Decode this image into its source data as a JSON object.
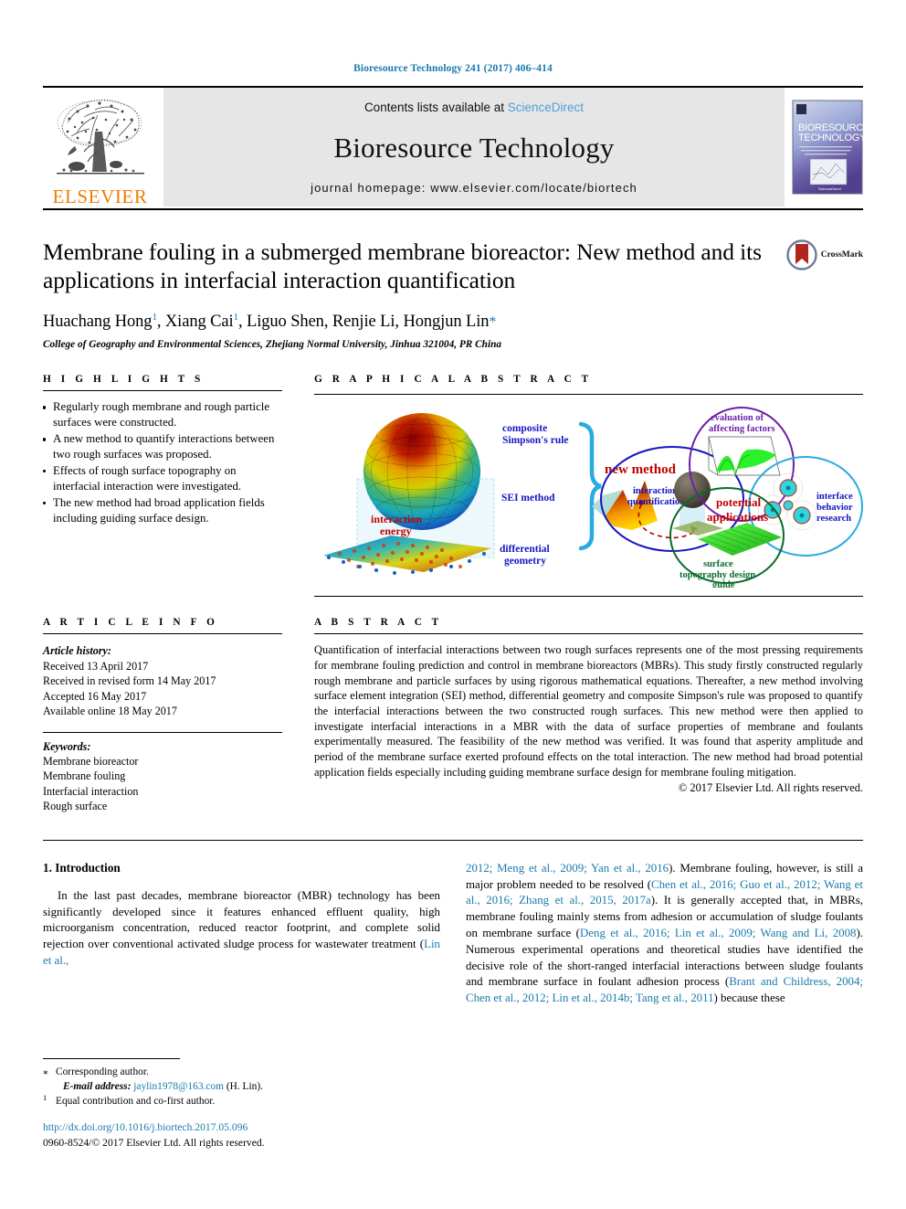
{
  "running_head": "Bioresource Technology 241 (2017) 406–414",
  "header": {
    "contents_prefix": "Contents lists available at ",
    "contents_link": "ScienceDirect",
    "journal_name": "Bioresource Technology",
    "homepage": "journal homepage: www.elsevier.com/locate/biortech",
    "publisher_logo_text": "ELSEVIER",
    "cover_title_line1": "BIORESOURCE",
    "cover_title_line2": "TECHNOLOGY"
  },
  "title": {
    "text": "Membrane fouling in a submerged membrane bioreactor: New method and its applications in interfacial interaction quantification",
    "crossmark_label": "CrossMark"
  },
  "authors": {
    "list": [
      {
        "name": "Huachang Hong",
        "sup": "1"
      },
      {
        "name": "Xiang Cai",
        "sup": "1"
      },
      {
        "name": "Liguo Shen",
        "sup": ""
      },
      {
        "name": "Renjie Li",
        "sup": ""
      },
      {
        "name": "Hongjun Lin",
        "sup": "*"
      }
    ],
    "affiliation": "College of Geography and Environmental Sciences, Zhejiang Normal University, Jinhua 321004, PR China"
  },
  "highlights": {
    "heading": "H I G H L I G H T S",
    "items": [
      "Regularly rough membrane and rough particle surfaces were constructed.",
      "A new method to quantify interactions between two rough surfaces was proposed.",
      "Effects of rough surface topography on interfacial interaction were investigated.",
      "The new method had broad application fields including guiding surface design."
    ]
  },
  "graphical_abstract": {
    "heading": "G R A P H I C A L  A B S T R A C T",
    "labels": {
      "composite_simpson": "composite\nSimpson's rule",
      "sei_method": "SEI method",
      "interaction_energy": "interaction\nenergy",
      "differential_geometry": "differential\ngeometry",
      "new_method": "new method",
      "interaction_quantification": "interaction\nquantification",
      "potential_applications": "potential\napplications",
      "evaluation_of_affecting_factors": "evaluation of\naffecting factors",
      "interface_behavior_research": "interface\nbehavior\nresearch",
      "surface_topography_design_guide": "surface\ntopography design\nguide"
    }
  },
  "article_info": {
    "heading": "A R T I C L E  I N F O",
    "history_label": "Article history:",
    "history": [
      "Received 13 April 2017",
      "Received in revised form 14 May 2017",
      "Accepted 16 May 2017",
      "Available online 18 May 2017"
    ],
    "keywords_label": "Keywords:",
    "keywords": [
      "Membrane bioreactor",
      "Membrane fouling",
      "Interfacial interaction",
      "Rough surface"
    ]
  },
  "abstract": {
    "heading": "A B S T R A C T",
    "text": "Quantification of interfacial interactions between two rough surfaces represents one of the most pressing requirements for membrane fouling prediction and control in membrane bioreactors (MBRs). This study firstly constructed regularly rough membrane and particle surfaces by using rigorous mathematical equations. Thereafter, a new method involving surface element integration (SEI) method, differential geometry and composite Simpson's rule was proposed to quantify the interfacial interactions between the two constructed rough surfaces. This new method were then applied to investigate interfacial interactions in a MBR with the data of surface properties of membrane and foulants experimentally measured. The feasibility of the new method was verified. It was found that asperity amplitude and period of the membrane surface exerted profound effects on the total interaction. The new method had broad potential application fields especially including guiding membrane surface design for membrane fouling mitigation.",
    "copyright": "© 2017 Elsevier Ltd. All rights reserved."
  },
  "introduction": {
    "heading": "1. Introduction",
    "left_paragraph_part1": "In the last past decades, membrane bioreactor (MBR) technology has been significantly developed since it features enhanced effluent quality, high microorganism concentration, reduced reactor footprint, and complete solid rejection over conventional activated sludge process for wastewater treatment (",
    "left_cite1": "Lin et al.,",
    "right_cite1": "2012; Meng et al., 2009; Yan et al., 2016",
    "right_text1": "). Membrane fouling, however, is still a major problem needed to be resolved (",
    "right_cite2": "Chen et al., 2016; Guo et al., 2012; Wang et al., 2016; Zhang et al., 2015, 2017a",
    "right_text2": "). It is generally accepted that, in MBRs, membrane fouling mainly stems from adhesion or accumulation of sludge foulants on membrane surface (",
    "right_cite3": "Deng et al., 2016; Lin et al., 2009; Wang and Li, 2008",
    "right_text3": "). Numerous experimental operations and theoretical studies have identified the decisive role of the short-ranged interfacial interactions between sludge foulants and membrane surface in foulant adhesion process (",
    "right_cite4": "Brant and Childress, 2004; Chen et al., 2012; Lin et al., 2014b; Tang et al., 2011",
    "right_text4": ") because these"
  },
  "footnotes": {
    "corresponding_marker": "⁎",
    "corresponding_text": "Corresponding author.",
    "email_label": "E-mail address:",
    "email": "jaylin1978@163.com",
    "email_suffix": "(H. Lin).",
    "equal_marker": "1",
    "equal_text": "Equal contribution and co-first author.",
    "doi": "http://dx.doi.org/10.1016/j.biortech.2017.05.096",
    "issn_line": "0960-8524/© 2017 Elsevier Ltd. All rights reserved."
  },
  "colors": {
    "link_blue": "#1a7aad",
    "sciencedirect_blue": "#4a9fd5",
    "elsevier_orange": "#f07d00",
    "band_gray": "#e6e6e6",
    "ga_red": "#c00000",
    "ga_blue": "#1515c0",
    "ga_cyan": "#29abe2",
    "ga_purple": "#6f1fa8",
    "ga_green": "#0a6b2a"
  }
}
